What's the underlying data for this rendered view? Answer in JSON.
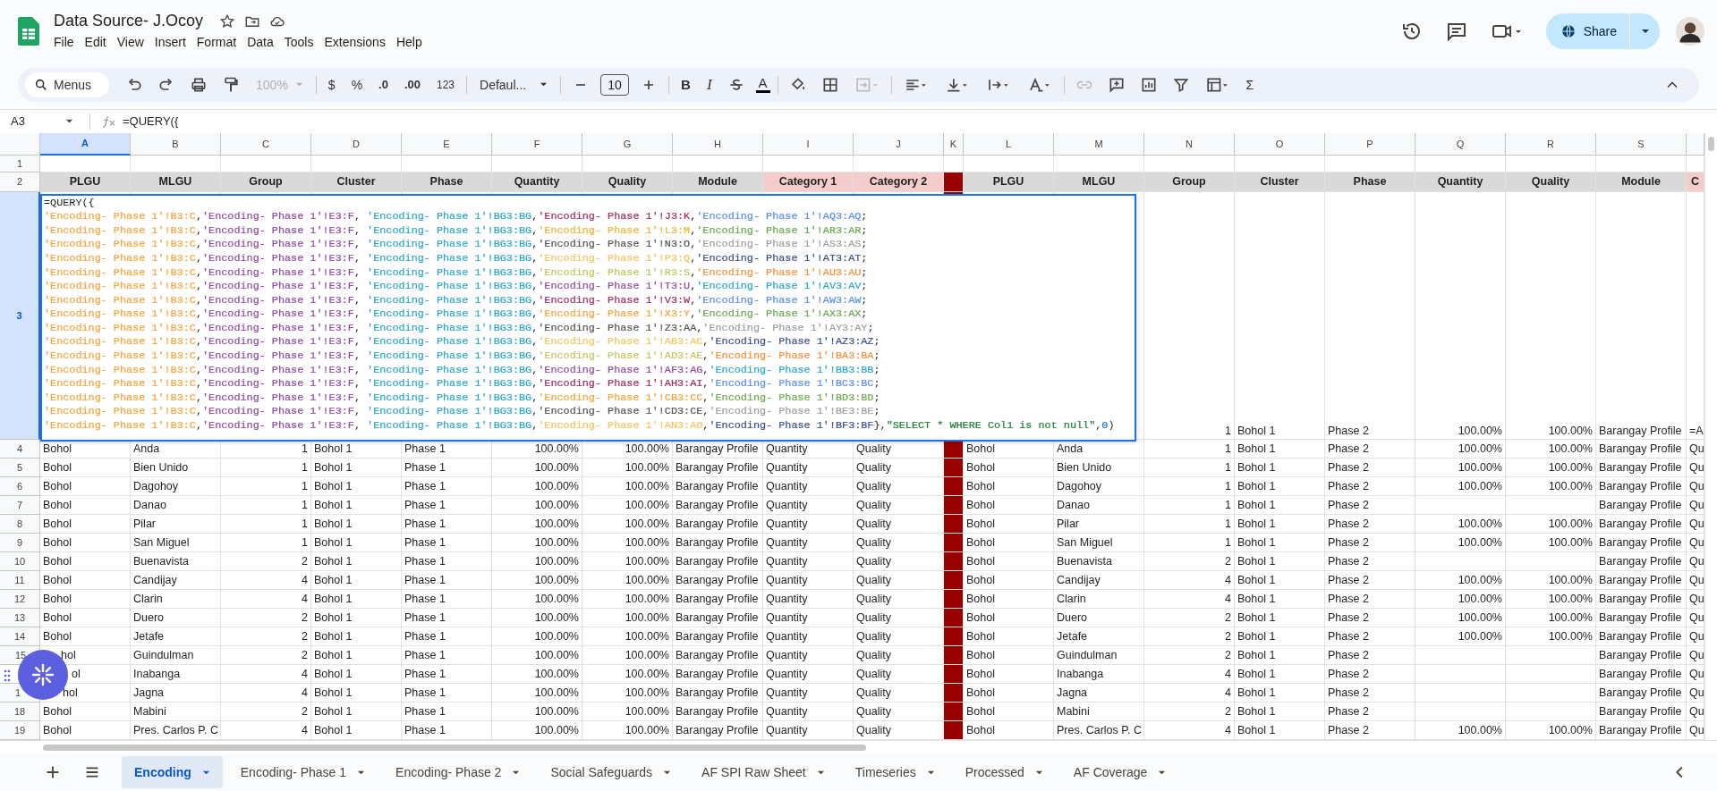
{
  "document": {
    "title": "Data Source- J.Ocoy",
    "menu": [
      "File",
      "Edit",
      "View",
      "Insert",
      "Format",
      "Data",
      "Tools",
      "Extensions",
      "Help"
    ],
    "share": "Share"
  },
  "toolbar": {
    "search": "Menus",
    "zoom": {
      "label": "100%",
      "disabled": true
    },
    "currency": "$",
    "percent": "%",
    "decrease_decimals": ".0",
    "increase_decimals": ".00",
    "number_format": "123",
    "font": "Defaul...",
    "font_size": "10",
    "bold": "B",
    "italic": "I",
    "text_color": "A",
    "sum": "Σ"
  },
  "formula_bar": {
    "cell": "A3",
    "formula": "=QUERY({"
  },
  "editor": {
    "lines": [
      [
        {
          "t": "=QUERY({"
        }
      ],
      [
        {
          "t": "'Encoding- Phase 1'!B3:C",
          "color": "#f6a33a"
        },
        {
          "t": ","
        },
        {
          "t": "'Encoding- Phase 1'!E3:F",
          "color": "#8f4aa5"
        },
        {
          "t": ", "
        },
        {
          "t": "'Encoding- Phase 1'!BG3:BG",
          "color": "#2aa7c9"
        },
        {
          "t": ","
        },
        {
          "t": "'Encoding- Phase 1'!J3:K",
          "color": "#a52a60"
        },
        {
          "t": ","
        },
        {
          "t": "'Encoding- Phase 1'!AQ3:AQ",
          "color": "#5b8def"
        },
        {
          "t": ";"
        }
      ],
      [
        {
          "t": "'Encoding- Phase 1'!B3:C",
          "color": "#f6a33a"
        },
        {
          "t": ","
        },
        {
          "t": "'Encoding- Phase 1'!E3:F",
          "color": "#8f4aa5"
        },
        {
          "t": ", "
        },
        {
          "t": "'Encoding- Phase 1'!BG3:BG",
          "color": "#2aa7c9"
        },
        {
          "t": ","
        },
        {
          "t": "'Encoding- Phase 1'!L3:M",
          "color": "#f0b429"
        },
        {
          "t": ","
        },
        {
          "t": "'Encoding- Phase 1'!AR3:AR",
          "color": "#6aa84f"
        },
        {
          "t": ";"
        }
      ],
      [
        {
          "t": "'Encoding- Phase 1'!B3:C",
          "color": "#f6a33a"
        },
        {
          "t": ","
        },
        {
          "t": "'Encoding- Phase 1'!E3:F",
          "color": "#8f4aa5"
        },
        {
          "t": ", "
        },
        {
          "t": "'Encoding- Phase 1'!BG3:BG",
          "color": "#2aa7c9"
        },
        {
          "t": ","
        },
        {
          "t": "'Encoding- Phase 1'!N3:O",
          "color": "#555555"
        },
        {
          "t": ","
        },
        {
          "t": "'Encoding- Phase 1'!AS3:AS",
          "color": "#9e9e9e"
        },
        {
          "t": ";"
        }
      ],
      [
        {
          "t": "'Encoding- Phase 1'!B3:C",
          "color": "#f6a33a"
        },
        {
          "t": ","
        },
        {
          "t": "'Encoding- Phase 1'!E3:F",
          "color": "#8f4aa5"
        },
        {
          "t": ", "
        },
        {
          "t": "'Encoding- Phase 1'!BG3:BG",
          "color": "#2aa7c9"
        },
        {
          "t": ","
        },
        {
          "t": "'Encoding- Phase 1'!P3:Q",
          "color": "#f5c35f"
        },
        {
          "t": ","
        },
        {
          "t": "'Encoding- Phase 1'!AT3:AT",
          "color": "#3c4f8a"
        },
        {
          "t": ";"
        }
      ],
      [
        {
          "t": "'Encoding- Phase 1'!B3:C",
          "color": "#f6a33a"
        },
        {
          "t": ","
        },
        {
          "t": "'Encoding- Phase 1'!E3:F",
          "color": "#8f4aa5"
        },
        {
          "t": ", "
        },
        {
          "t": "'Encoding- Phase 1'!BG3:BG",
          "color": "#2aa7c9"
        },
        {
          "t": ","
        },
        {
          "t": "'Encoding- Phase 1'!R3:S",
          "color": "#bfc85a"
        },
        {
          "t": ","
        },
        {
          "t": "'Encoding- Phase 1'!AU3:AU",
          "color": "#f58f3a"
        },
        {
          "t": ";"
        }
      ],
      [
        {
          "t": "'Encoding- Phase 1'!B3:C",
          "color": "#f6a33a"
        },
        {
          "t": ","
        },
        {
          "t": "'Encoding- Phase 1'!E3:F",
          "color": "#8f4aa5"
        },
        {
          "t": ", "
        },
        {
          "t": "'Encoding- Phase 1'!BG3:BG",
          "color": "#2aa7c9"
        },
        {
          "t": ","
        },
        {
          "t": "'Encoding- Phase 1'!T3:U",
          "color": "#8f4aa5"
        },
        {
          "t": ","
        },
        {
          "t": "'Encoding- Phase 1'!AV3:AV",
          "color": "#2aa7c9"
        },
        {
          "t": ";"
        }
      ],
      [
        {
          "t": "'Encoding- Phase 1'!B3:C",
          "color": "#f6a33a"
        },
        {
          "t": ","
        },
        {
          "t": "'Encoding- Phase 1'!E3:F",
          "color": "#8f4aa5"
        },
        {
          "t": ", "
        },
        {
          "t": "'Encoding- Phase 1'!BG3:BG",
          "color": "#2aa7c9"
        },
        {
          "t": ","
        },
        {
          "t": "'Encoding- Phase 1'!V3:W",
          "color": "#a52a60"
        },
        {
          "t": ","
        },
        {
          "t": "'Encoding- Phase 1'!AW3:AW",
          "color": "#5b8def"
        },
        {
          "t": ";"
        }
      ],
      [
        {
          "t": "'Encoding- Phase 1'!B3:C",
          "color": "#f6a33a"
        },
        {
          "t": ","
        },
        {
          "t": "'Encoding- Phase 1'!E3:F",
          "color": "#8f4aa5"
        },
        {
          "t": ", "
        },
        {
          "t": "'Encoding- Phase 1'!BG3:BG",
          "color": "#2aa7c9"
        },
        {
          "t": ","
        },
        {
          "t": "'Encoding- Phase 1'!X3:Y",
          "color": "#f6a33a"
        },
        {
          "t": ","
        },
        {
          "t": "'Encoding- Phase 1'!AX3:AX",
          "color": "#6aa84f"
        },
        {
          "t": ";"
        }
      ],
      [
        {
          "t": "'Encoding- Phase 1'!B3:C",
          "color": "#f6a33a"
        },
        {
          "t": ","
        },
        {
          "t": "'Encoding- Phase 1'!E3:F",
          "color": "#8f4aa5"
        },
        {
          "t": ", "
        },
        {
          "t": "'Encoding- Phase 1'!BG3:BG",
          "color": "#2aa7c9"
        },
        {
          "t": ","
        },
        {
          "t": "'Encoding- Phase 1'!Z3:AA",
          "color": "#555555"
        },
        {
          "t": ","
        },
        {
          "t": "'Encoding- Phase 1'!AY3:AY",
          "color": "#9e9e9e"
        },
        {
          "t": ";"
        }
      ],
      [
        {
          "t": "'Encoding- Phase 1'!B3:C",
          "color": "#f6a33a"
        },
        {
          "t": ","
        },
        {
          "t": "'Encoding- Phase 1'!E3:F",
          "color": "#8f4aa5"
        },
        {
          "t": ", "
        },
        {
          "t": "'Encoding- Phase 1'!BG3:BG",
          "color": "#2aa7c9"
        },
        {
          "t": ","
        },
        {
          "t": "'Encoding- Phase 1'!AB3:AC",
          "color": "#f5c35f"
        },
        {
          "t": ","
        },
        {
          "t": "'Encoding- Phase 1'!AZ3:AZ",
          "color": "#3c4f8a"
        },
        {
          "t": ";"
        }
      ],
      [
        {
          "t": "'Encoding- Phase 1'!B3:C",
          "color": "#f6a33a"
        },
        {
          "t": ","
        },
        {
          "t": "'Encoding- Phase 1'!E3:F",
          "color": "#8f4aa5"
        },
        {
          "t": ", "
        },
        {
          "t": "'Encoding- Phase 1'!BG3:BG",
          "color": "#2aa7c9"
        },
        {
          "t": ","
        },
        {
          "t": "'Encoding- Phase 1'!AD3:AE",
          "color": "#bfc85a"
        },
        {
          "t": ","
        },
        {
          "t": "'Encoding- Phase 1'!BA3:BA",
          "color": "#f58f3a"
        },
        {
          "t": ";"
        }
      ],
      [
        {
          "t": "'Encoding- Phase 1'!B3:C",
          "color": "#f6a33a"
        },
        {
          "t": ","
        },
        {
          "t": "'Encoding- Phase 1'!E3:F",
          "color": "#8f4aa5"
        },
        {
          "t": ", "
        },
        {
          "t": "'Encoding- Phase 1'!BG3:BG",
          "color": "#2aa7c9"
        },
        {
          "t": ","
        },
        {
          "t": "'Encoding- Phase 1'!AF3:AG",
          "color": "#8f4aa5"
        },
        {
          "t": ","
        },
        {
          "t": "'Encoding- Phase 1'!BB3:BB",
          "color": "#2aa7c9"
        },
        {
          "t": ";"
        }
      ],
      [
        {
          "t": "'Encoding- Phase 1'!B3:C",
          "color": "#f6a33a"
        },
        {
          "t": ","
        },
        {
          "t": "'Encoding- Phase 1'!E3:F",
          "color": "#8f4aa5"
        },
        {
          "t": ", "
        },
        {
          "t": "'Encoding- Phase 1'!BG3:BG",
          "color": "#2aa7c9"
        },
        {
          "t": ","
        },
        {
          "t": "'Encoding- Phase 1'!AH3:AI",
          "color": "#a52a60"
        },
        {
          "t": ","
        },
        {
          "t": "'Encoding- Phase 1'!BC3:BC",
          "color": "#5b8def"
        },
        {
          "t": ";"
        }
      ],
      [
        {
          "t": "'Encoding- Phase 1'!B3:C",
          "color": "#f6a33a"
        },
        {
          "t": ","
        },
        {
          "t": "'Encoding- Phase 1'!E3:F",
          "color": "#8f4aa5"
        },
        {
          "t": ", "
        },
        {
          "t": "'Encoding- Phase 1'!BG3:BG",
          "color": "#2aa7c9"
        },
        {
          "t": ","
        },
        {
          "t": "'Encoding- Phase 1'!CB3:CC",
          "color": "#f6a33a"
        },
        {
          "t": ","
        },
        {
          "t": "'Encoding- Phase 1'!BD3:BD",
          "color": "#6aa84f"
        },
        {
          "t": ";"
        }
      ],
      [
        {
          "t": "'Encoding- Phase 1'!B3:C",
          "color": "#f6a33a"
        },
        {
          "t": ","
        },
        {
          "t": "'Encoding- Phase 1'!E3:F",
          "color": "#8f4aa5"
        },
        {
          "t": ", "
        },
        {
          "t": "'Encoding- Phase 1'!BG3:BG",
          "color": "#2aa7c9"
        },
        {
          "t": ","
        },
        {
          "t": "'Encoding- Phase 1'!CD3:CE",
          "color": "#555555"
        },
        {
          "t": ","
        },
        {
          "t": "'Encoding- Phase 1'!BE3:BE",
          "color": "#9e9e9e"
        },
        {
          "t": ";"
        }
      ],
      [
        {
          "t": "'Encoding- Phase 1'!B3:C",
          "color": "#f6a33a"
        },
        {
          "t": ","
        },
        {
          "t": "'Encoding- Phase 1'!E3:F",
          "color": "#8f4aa5"
        },
        {
          "t": ", "
        },
        {
          "t": "'Encoding- Phase 1'!BG3:BG",
          "color": "#2aa7c9"
        },
        {
          "t": ","
        },
        {
          "t": "'Encoding- Phase 1'!AN3:AO",
          "color": "#f5c35f"
        },
        {
          "t": ","
        },
        {
          "t": "'Encoding- Phase 1'!BF3:BF",
          "color": "#3c4f8a"
        },
        {
          "t": "},"
        },
        {
          "t": "\"SELECT * WHERE Col1 is not null\"",
          "color": "#188038"
        },
        {
          "t": ","
        },
        {
          "t": "0",
          "color": "#1a73e8"
        },
        {
          "t": ")"
        }
      ]
    ]
  },
  "columns": [
    {
      "letter": "A",
      "kind": "text",
      "selected": true
    },
    {
      "letter": "B",
      "kind": "text",
      "selected": false
    },
    {
      "letter": "C",
      "kind": "number",
      "selected": false
    },
    {
      "letter": "D",
      "kind": "text",
      "selected": false
    },
    {
      "letter": "E",
      "kind": "text",
      "selected": false
    },
    {
      "letter": "F",
      "kind": "number",
      "selected": false
    },
    {
      "letter": "G",
      "kind": "number",
      "selected": false
    },
    {
      "letter": "H",
      "kind": "text",
      "selected": false
    },
    {
      "letter": "I",
      "kind": "text",
      "selected": false
    },
    {
      "letter": "J",
      "kind": "text",
      "selected": false
    },
    {
      "letter": "K",
      "kind": "separator",
      "selected": false,
      "color": "#990000"
    },
    {
      "letter": "L",
      "kind": "text",
      "selected": false
    },
    {
      "letter": "M",
      "kind": "text",
      "selected": false
    },
    {
      "letter": "N",
      "kind": "number",
      "selected": false
    },
    {
      "letter": "O",
      "kind": "text",
      "selected": false
    },
    {
      "letter": "P",
      "kind": "text",
      "selected": false
    },
    {
      "letter": "Q",
      "kind": "number",
      "selected": false
    },
    {
      "letter": "R",
      "kind": "number",
      "selected": false
    },
    {
      "letter": "S",
      "kind": "text",
      "selected": false
    },
    {
      "kind": "text",
      "selected": false
    }
  ],
  "rows": [
    {
      "num": "1",
      "kind": "blank",
      "selected": false
    },
    {
      "num": "2",
      "kind": "header",
      "selected": false,
      "cells": [
        {
          "t": "PLGU",
          "color": "#d9d9d9"
        },
        {
          "t": "MLGU",
          "color": "#d9d9d9"
        },
        {
          "t": "Group",
          "color": "#d9d9d9"
        },
        {
          "t": "Cluster",
          "color": "#d9d9d9"
        },
        {
          "t": "Phase",
          "color": "#d9d9d9"
        },
        {
          "t": "Quantity",
          "color": "#d9d9d9"
        },
        {
          "t": "Quality",
          "color": "#d9d9d9"
        },
        {
          "t": "Module",
          "color": "#d9d9d9"
        },
        {
          "t": "Category 1",
          "color": "#f4cccc"
        },
        {
          "t": "Category 2",
          "color": "#f4cccc"
        },
        null,
        {
          "t": "PLGU",
          "color": "#d9d9d9"
        },
        {
          "t": "MLGU",
          "color": "#d9d9d9"
        },
        {
          "t": "Group",
          "color": "#d9d9d9"
        },
        {
          "t": "Cluster",
          "color": "#d9d9d9"
        },
        {
          "t": "Phase",
          "color": "#d9d9d9"
        },
        {
          "t": "Quantity",
          "color": "#d9d9d9"
        },
        {
          "t": "Quality",
          "color": "#d9d9d9"
        },
        {
          "t": "Module",
          "color": "#d9d9d9"
        },
        {
          "t": "C",
          "color": "#f4cccc"
        }
      ]
    },
    {
      "num": "3",
      "kind": "editing",
      "selected": true,
      "cells": [
        null,
        null,
        null,
        null,
        null,
        null,
        null,
        null,
        null,
        null,
        null,
        null,
        null,
        "1",
        "Bohol 1",
        "Phase 2",
        "100.00%",
        "100.00%",
        "Barangay Profile",
        "=A"
      ]
    },
    {
      "num": "4",
      "kind": "data",
      "selected": false,
      "cells": [
        "Bohol",
        "Anda",
        "1",
        "Bohol 1",
        "Phase 1",
        "100.00%",
        "100.00%",
        "Barangay Profile",
        "Quantity",
        "Quality",
        null,
        "Bohol",
        "Anda",
        "1",
        "Bohol 1",
        "Phase 2",
        "100.00%",
        "100.00%",
        "Barangay Profile",
        "Qu"
      ]
    },
    {
      "num": "5",
      "kind": "data",
      "selected": false,
      "cells": [
        "Bohol",
        "Bien Unido",
        "1",
        "Bohol 1",
        "Phase 1",
        "100.00%",
        "100.00%",
        "Barangay Profile",
        "Quantity",
        "Quality",
        null,
        "Bohol",
        "Bien Unido",
        "1",
        "Bohol 1",
        "Phase 2",
        "100.00%",
        "100.00%",
        "Barangay Profile",
        "Qu"
      ]
    },
    {
      "num": "6",
      "kind": "data",
      "selected": false,
      "cells": [
        "Bohol",
        "Dagohoy",
        "1",
        "Bohol 1",
        "Phase 1",
        "100.00%",
        "100.00%",
        "Barangay Profile",
        "Quantity",
        "Quality",
        null,
        "Bohol",
        "Dagohoy",
        "1",
        "Bohol 1",
        "Phase 2",
        "100.00%",
        "100.00%",
        "Barangay Profile",
        "Qu"
      ]
    },
    {
      "num": "7",
      "kind": "data",
      "selected": false,
      "cells": [
        "Bohol",
        "Danao",
        "1",
        "Bohol 1",
        "Phase 1",
        "100.00%",
        "100.00%",
        "Barangay Profile",
        "Quantity",
        "Quality",
        null,
        "Bohol",
        "Danao",
        "1",
        "Bohol 1",
        "Phase 2",
        null,
        null,
        "Barangay Profile",
        "Qu"
      ]
    },
    {
      "num": "8",
      "kind": "data",
      "selected": false,
      "cells": [
        "Bohol",
        "Pilar",
        "1",
        "Bohol 1",
        "Phase 1",
        "100.00%",
        "100.00%",
        "Barangay Profile",
        "Quantity",
        "Quality",
        null,
        "Bohol",
        "Pilar",
        "1",
        "Bohol 1",
        "Phase 2",
        "100.00%",
        "100.00%",
        "Barangay Profile",
        "Qu"
      ]
    },
    {
      "num": "9",
      "kind": "data",
      "selected": false,
      "cells": [
        "Bohol",
        "San Miguel",
        "1",
        "Bohol 1",
        "Phase 1",
        "100.00%",
        "100.00%",
        "Barangay Profile",
        "Quantity",
        "Quality",
        null,
        "Bohol",
        "San Miguel",
        "1",
        "Bohol 1",
        "Phase 2",
        "100.00%",
        "100.00%",
        "Barangay Profile",
        "Qu"
      ]
    },
    {
      "num": "10",
      "kind": "data",
      "selected": false,
      "cells": [
        "Bohol",
        "Buenavista",
        "2",
        "Bohol 1",
        "Phase 1",
        "100.00%",
        "100.00%",
        "Barangay Profile",
        "Quantity",
        "Quality",
        null,
        "Bohol",
        "Buenavista",
        "2",
        "Bohol 1",
        "Phase 2",
        null,
        null,
        "Barangay Profile",
        "Qu"
      ]
    },
    {
      "num": "11",
      "kind": "data",
      "selected": false,
      "cells": [
        "Bohol",
        "Candijay",
        "4",
        "Bohol 1",
        "Phase 1",
        "100.00%",
        "100.00%",
        "Barangay Profile",
        "Quantity",
        "Quality",
        null,
        "Bohol",
        "Candijay",
        "4",
        "Bohol 1",
        "Phase 2",
        "100.00%",
        "100.00%",
        "Barangay Profile",
        "Qu"
      ]
    },
    {
      "num": "12",
      "kind": "data",
      "selected": false,
      "cells": [
        "Bohol",
        "Clarin",
        "4",
        "Bohol 1",
        "Phase 1",
        "100.00%",
        "100.00%",
        "Barangay Profile",
        "Quantity",
        "Quality",
        null,
        "Bohol",
        "Clarin",
        "4",
        "Bohol 1",
        "Phase 2",
        "100.00%",
        "100.00%",
        "Barangay Profile",
        "Qu"
      ]
    },
    {
      "num": "13",
      "kind": "data",
      "selected": false,
      "cells": [
        "Bohol",
        "Duero",
        "2",
        "Bohol 1",
        "Phase 1",
        "100.00%",
        "100.00%",
        "Barangay Profile",
        "Quantity",
        "Quality",
        null,
        "Bohol",
        "Duero",
        "2",
        "Bohol 1",
        "Phase 2",
        "100.00%",
        "100.00%",
        "Barangay Profile",
        "Qu"
      ]
    },
    {
      "num": "14",
      "kind": "data",
      "selected": false,
      "cells": [
        "Bohol",
        "Jetafe",
        "2",
        "Bohol 1",
        "Phase 1",
        "100.00%",
        "100.00%",
        "Barangay Profile",
        "Quantity",
        "Quality",
        null,
        "Bohol",
        "Jetafe",
        "2",
        "Bohol 1",
        "Phase 2",
        "100.00%",
        "100.00%",
        "Barangay Profile",
        "Qu"
      ]
    },
    {
      "num": "15",
      "kind": "data",
      "selected": false,
      "cells": [
        "hol",
        "Guindulman",
        "2",
        "Bohol 1",
        "Phase 1",
        "100.00%",
        "100.00%",
        "Barangay Profile",
        "Quantity",
        "Quality",
        null,
        "Bohol",
        "Guindulman",
        "2",
        "Bohol 1",
        "Phase 2",
        null,
        null,
        "Barangay Profile",
        "Qu"
      ]
    },
    {
      "kind": "data",
      "selected": false,
      "cells": [
        "ol",
        "Inabanga",
        "4",
        "Bohol 1",
        "Phase 1",
        "100.00%",
        "100.00%",
        "Barangay Profile",
        "Quantity",
        "Quality",
        null,
        "Bohol",
        "Inabanga",
        "4",
        "Bohol 1",
        "Phase 2",
        null,
        null,
        "Barangay Profile",
        "Qu"
      ]
    },
    {
      "num": "1",
      "kind": "data",
      "selected": false,
      "cells": [
        "hol",
        "Jagna",
        "4",
        "Bohol 1",
        "Phase 1",
        "100.00%",
        "100.00%",
        "Barangay Profile",
        "Quantity",
        "Quality",
        null,
        "Bohol",
        "Jagna",
        "4",
        "Bohol 1",
        "Phase 2",
        null,
        null,
        "Barangay Profile",
        "Qu"
      ]
    },
    {
      "num": "18",
      "kind": "data",
      "selected": false,
      "cells": [
        "Bohol",
        "Mabini",
        "2",
        "Bohol 1",
        "Phase 1",
        "100.00%",
        "100.00%",
        "Barangay Profile",
        "Quantity",
        "Quality",
        null,
        "Bohol",
        "Mabini",
        "2",
        "Bohol 1",
        "Phase 2",
        null,
        null,
        "Barangay Profile",
        "Qu"
      ]
    },
    {
      "num": "19",
      "kind": "data",
      "selected": false,
      "cells": [
        "Bohol",
        "Pres. Carlos P. C",
        "4",
        "Bohol 1",
        "Phase 1",
        "100.00%",
        "100.00%",
        "Barangay Profile",
        "Quantity",
        "Quality",
        null,
        "Bohol",
        "Pres. Carlos P. C",
        "4",
        "Bohol 1",
        "Phase 2",
        "100.00%",
        "100.00%",
        "Barangay Profile",
        "Qu"
      ]
    }
  ],
  "sheet_tabs": [
    {
      "label": "Encoding",
      "selected": true
    },
    {
      "label": "Encoding- Phase 1",
      "selected": false
    },
    {
      "label": "Encoding- Phase 2",
      "selected": false
    },
    {
      "label": "Social Safeguards",
      "selected": false
    },
    {
      "label": "AF SPI Raw Sheet",
      "selected": false
    },
    {
      "label": "Timeseries",
      "selected": false
    },
    {
      "label": "Processed",
      "selected": false
    },
    {
      "label": "AF Coverage",
      "selected": false
    }
  ]
}
